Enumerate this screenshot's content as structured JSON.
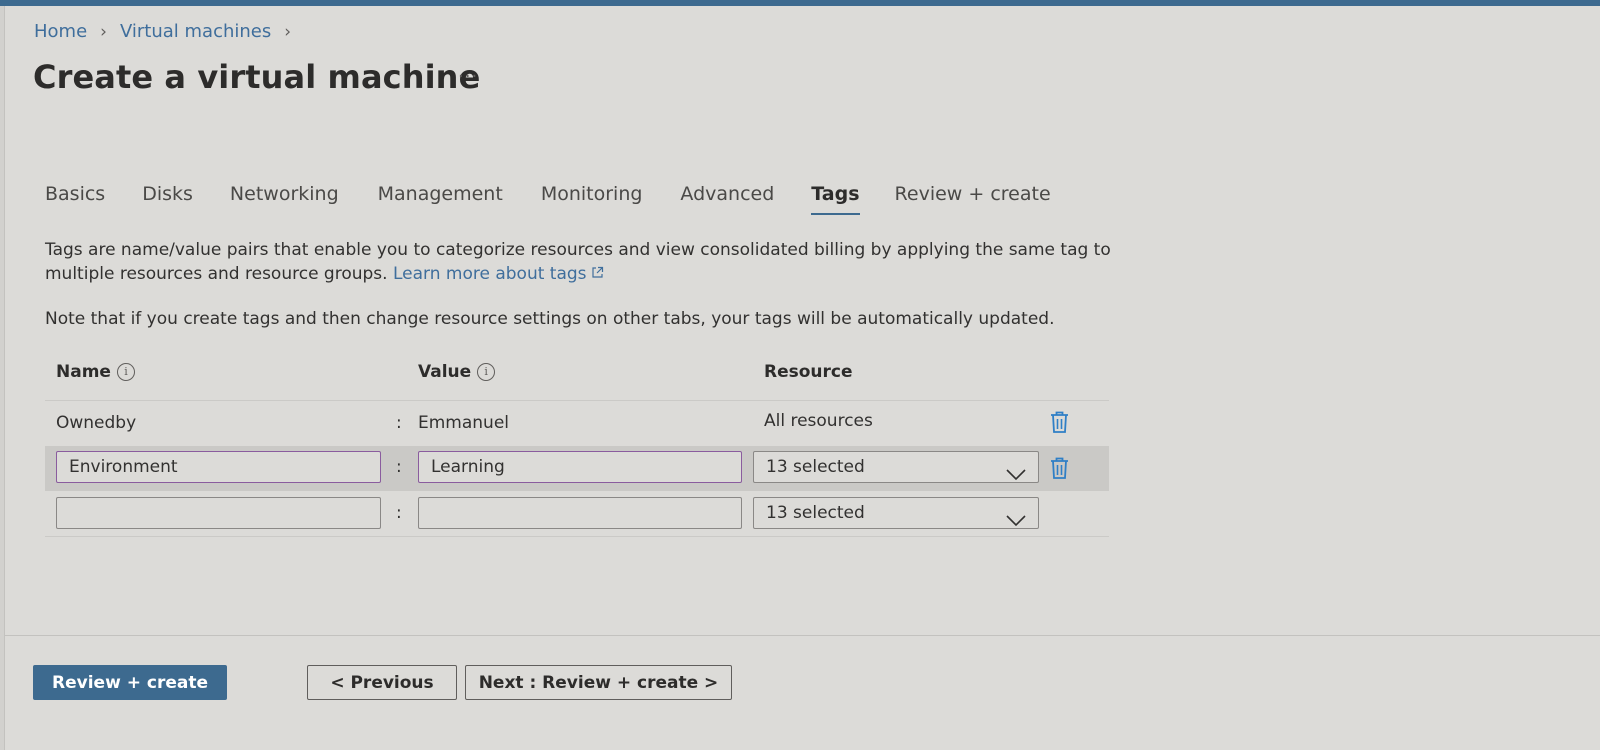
{
  "breadcrumb": {
    "home": "Home",
    "section": "Virtual machines"
  },
  "page": {
    "title": "Create a virtual machine",
    "more": "···"
  },
  "tabs": [
    {
      "label": "Basics"
    },
    {
      "label": "Disks"
    },
    {
      "label": "Networking"
    },
    {
      "label": "Management"
    },
    {
      "label": "Monitoring"
    },
    {
      "label": "Advanced"
    },
    {
      "label": "Tags",
      "active": true
    },
    {
      "label": "Review + create"
    }
  ],
  "description": {
    "text": "Tags are name/value pairs that enable you to categorize resources and view consolidated billing by applying the same tag to multiple resources and resource groups.",
    "link": "Learn more about tags"
  },
  "note": "Note that if you create tags and then change resource settings on other tabs, your tags will be automatically updated.",
  "table": {
    "headers": {
      "name": "Name",
      "value": "Value",
      "resource": "Resource"
    },
    "rows": [
      {
        "name": "Ownedby",
        "separator": ":",
        "value": "Emmanuel",
        "resource": "All resources"
      },
      {
        "name": "Environment",
        "separator": ":",
        "value": "Learning",
        "resource": "13 selected"
      },
      {
        "name": "",
        "separator": ":",
        "value": "",
        "resource": "13 selected"
      }
    ]
  },
  "footer": {
    "review_create": "Review + create",
    "previous": "< Previous",
    "next": "Next : Review + create >"
  },
  "colors": {
    "accent": "#3d6a8f",
    "link": "#3f6e9c",
    "delete_icon": "#2f7fc6",
    "focus_border": "#8a5c9e"
  },
  "icons": {
    "info": "info-icon",
    "delete": "trash-icon",
    "dropdown": "chevron-down-icon",
    "external": "external-link-icon",
    "breadcrumb_sep": "chevron-right-icon"
  }
}
